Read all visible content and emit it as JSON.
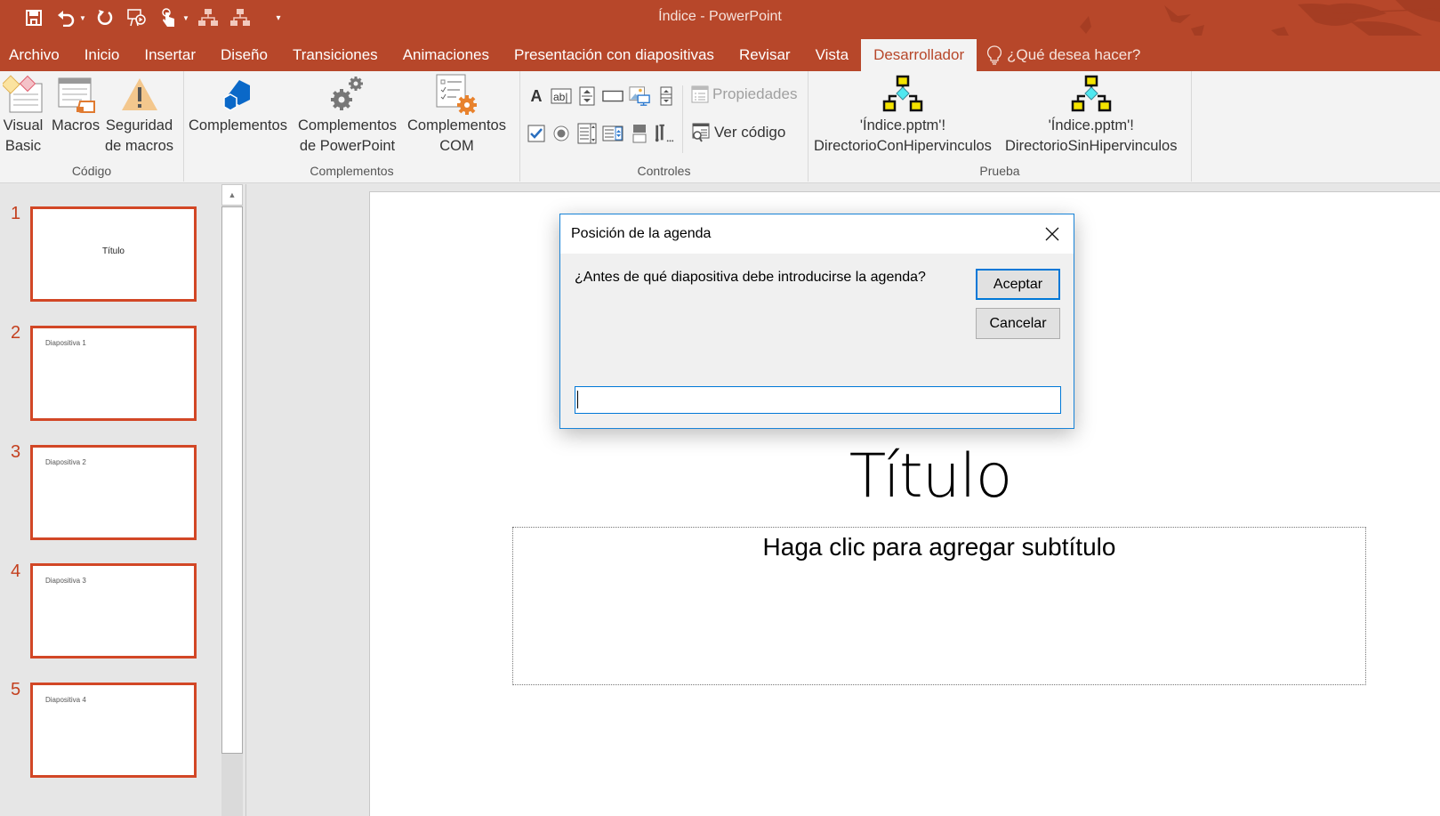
{
  "window": {
    "title": "Índice - PowerPoint"
  },
  "quick_access": [
    {
      "name": "save-icon",
      "glyph": "💾"
    },
    {
      "name": "undo-icon",
      "glyph": "↶"
    },
    {
      "name": "redo-icon",
      "glyph": "↻"
    },
    {
      "name": "start-from-beginning-icon",
      "glyph": "▶"
    },
    {
      "name": "touch-mode-icon",
      "glyph": "☝"
    },
    {
      "name": "macro-con-hipervinculos-icon",
      "glyph": "⛬"
    },
    {
      "name": "macro-sin-hipervinculos-icon",
      "glyph": "⛬"
    },
    {
      "name": "customize-qat-icon",
      "glyph": "▾"
    }
  ],
  "tabs": [
    {
      "label": "Archivo",
      "active": false
    },
    {
      "label": "Inicio",
      "active": false
    },
    {
      "label": "Insertar",
      "active": false
    },
    {
      "label": "Diseño",
      "active": false
    },
    {
      "label": "Transiciones",
      "active": false
    },
    {
      "label": "Animaciones",
      "active": false
    },
    {
      "label": "Presentación con diapositivas",
      "active": false
    },
    {
      "label": "Revisar",
      "active": false
    },
    {
      "label": "Vista",
      "active": false
    },
    {
      "label": "Desarrollador",
      "active": true
    }
  ],
  "tell_me": "¿Qué desea hacer?",
  "ribbon": {
    "codigo": {
      "label": "Código",
      "visual_basic": {
        "line1": "Visual",
        "line2": "Basic"
      },
      "macros": {
        "line1": "Macros",
        "line2": ""
      },
      "seguridad": {
        "line1": "Seguridad",
        "line2": "de macros"
      }
    },
    "complementos": {
      "label": "Complementos",
      "complementos": {
        "line1": "Complementos",
        "line2": ""
      },
      "powerpoint": {
        "line1": "Complementos",
        "line2": "de PowerPoint"
      },
      "com": {
        "line1": "Complementos",
        "line2": "COM"
      }
    },
    "controles": {
      "label": "Controles",
      "propiedades": "Propiedades",
      "ver_codigo": "Ver código"
    },
    "prueba": {
      "label": "Prueba",
      "con": {
        "line1": "'Índice.pptm'!",
        "line2": "DirectorioConHipervinculos"
      },
      "sin": {
        "line1": "'Índice.pptm'!",
        "line2": "DirectorioSinHipervinculos"
      }
    }
  },
  "slides": [
    {
      "number": "1",
      "text": "Título",
      "layout": "title"
    },
    {
      "number": "2",
      "text": "Diapositiva 1",
      "layout": "content"
    },
    {
      "number": "3",
      "text": "Diapositiva 2",
      "layout": "content"
    },
    {
      "number": "4",
      "text": "Diapositiva 3",
      "layout": "content"
    },
    {
      "number": "5",
      "text": "Diapositiva 4",
      "layout": "content"
    }
  ],
  "current_slide": {
    "title": "Título",
    "subtitle_placeholder": "Haga clic para agregar subtítulo"
  },
  "dialog": {
    "title": "Posición de la agenda",
    "prompt": "¿Antes de qué diapositiva debe introducirse la agenda?",
    "ok_label": "Aceptar",
    "cancel_label": "Cancelar",
    "input_value": ""
  },
  "colors": {
    "accent": "#b7472a",
    "thumb_border": "#d24726",
    "dialog_border": "#0078d7"
  }
}
